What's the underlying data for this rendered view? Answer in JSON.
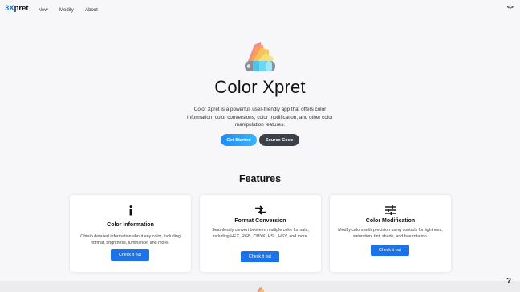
{
  "header": {
    "logo_accent": "3X",
    "logo_rest": "pret",
    "nav": [
      "New",
      "Modify",
      "About"
    ],
    "code_toggle": "<>"
  },
  "hero": {
    "title": "Color Xpret",
    "description": "Color Xpret is a powerful, user-friendly app that offers color information, color conversions, color modification, and other color manipulation features.",
    "get_started_label": "Get Started",
    "source_code_label": "Source Code"
  },
  "features": {
    "title": "Features",
    "cards": [
      {
        "icon": "info-icon",
        "title": "Color Information",
        "description": "Obtain detailed information about any color, including format, brightness, luminance, and more.",
        "button": "Check it out"
      },
      {
        "icon": "convert-arrows-icon",
        "title": "Format Conversion",
        "description": "Seamlessly convert between multiple color formats, including HEX, RGB, CMYK, HSL, HSV, and more.",
        "button": "Check it out"
      },
      {
        "icon": "sliders-icon",
        "title": "Color Modification",
        "description": "Modify colors with precision using controls for lightness, saturation, tint, shade, and hue rotation.",
        "button": "Check it out"
      }
    ]
  },
  "help_label": "?",
  "colors": {
    "accent": "#1a73e8",
    "dark_button": "#3b3f47",
    "background": "#f7f7f9"
  }
}
